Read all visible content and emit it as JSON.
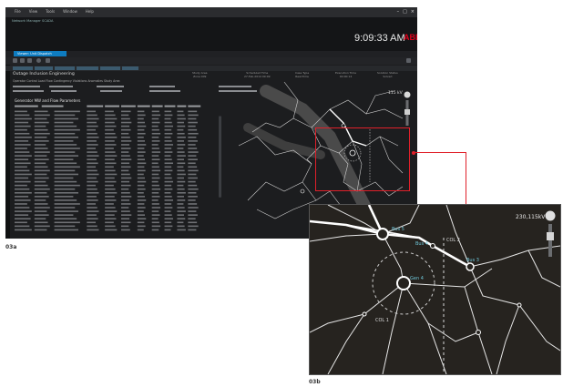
{
  "screenshot_a": {
    "app_title": "Network Manager",
    "menu": [
      "File",
      "View",
      "Tools",
      "Window",
      "Help"
    ],
    "subtitle": "Network Manager SCADA",
    "clock": "9:09:33 AM",
    "brand": "ABB",
    "active_tab": "Viewer: Unit Dispatch",
    "section_title": "Outage Inclusion Engineering",
    "filter_line": "Operator Control   Load Flow   Contingency   Violations   Anomalies   Study Area",
    "summary": [
      {
        "label": "Study Area",
        "value": "Zone 009"
      },
      {
        "label": "Scheduled Time",
        "value": "27-Feb-2014 09:09"
      },
      {
        "label": "Case Type",
        "value": "Real-Time"
      },
      {
        "label": "Execution Time",
        "value": "00:00:14"
      },
      {
        "label": "Solution Status",
        "value": "Solved"
      }
    ],
    "table_title": "Generator MW and Flow Parameters",
    "kv_label": "115 kV",
    "caption": "03a"
  },
  "screenshot_b": {
    "kv_label": "230,115kV",
    "node_labels": [
      "Bus 5",
      "Bus 4",
      "Gen 4",
      "Bus 3",
      "COL 1",
      "COL 2"
    ],
    "caption": "03b"
  },
  "colors": {
    "accent": "#0e7cc0",
    "highlight": "#e0202a",
    "brand": "#e2001a",
    "map_bg": "#26231f"
  }
}
